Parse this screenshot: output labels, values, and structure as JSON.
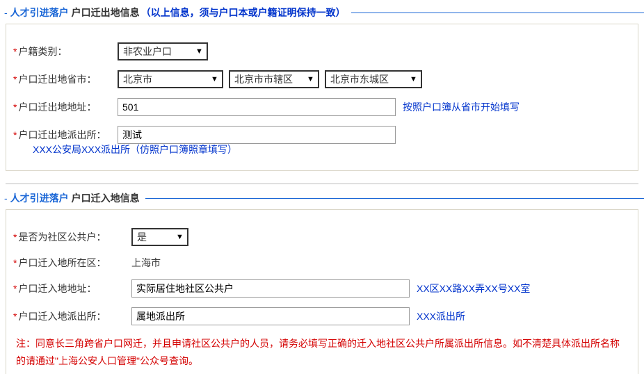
{
  "section1": {
    "lead": "人才引进落户",
    "sub": "户口迁出地信息",
    "note": "（以上信息，须与户口本或户籍证明保持一致）",
    "hukou_type": {
      "label": "户籍类别：",
      "value": "非农业户口"
    },
    "move_out_region": {
      "label": "户口迁出地省市：",
      "province": "北京市",
      "city": "北京市市辖区",
      "district": "北京市东城区"
    },
    "move_out_address": {
      "label": "户口迁出地地址：",
      "value": "501",
      "hint": "按照户口簿从省市开始填写"
    },
    "move_out_police": {
      "label": "户口迁出地派出所：",
      "value": "测试",
      "example": "XXX公安局XXX派出所（仿照户口簿照章填写）"
    }
  },
  "section2": {
    "lead": "人才引进落户",
    "sub": "户口迁入地信息",
    "community": {
      "label": "是否为社区公共户：",
      "value": "是"
    },
    "in_region": {
      "label": "户口迁入地所在区：",
      "value": "上海市"
    },
    "in_address": {
      "label": "户口迁入地地址：",
      "value": "实际居住地社区公共户",
      "hint": "XX区XX路XX弄XX号XX室"
    },
    "in_police": {
      "label": "户口迁入地派出所：",
      "value": "属地派出所",
      "hint": "XXX派出所"
    },
    "note": "注：同意长三角跨省户口网迁，并且申请社区公共户的人员，请务必填写正确的迁入地社区公共户所属派出所信息。如不清楚具体派出所名称的请通过\"上海公安人口管理\"公众号查询。"
  }
}
